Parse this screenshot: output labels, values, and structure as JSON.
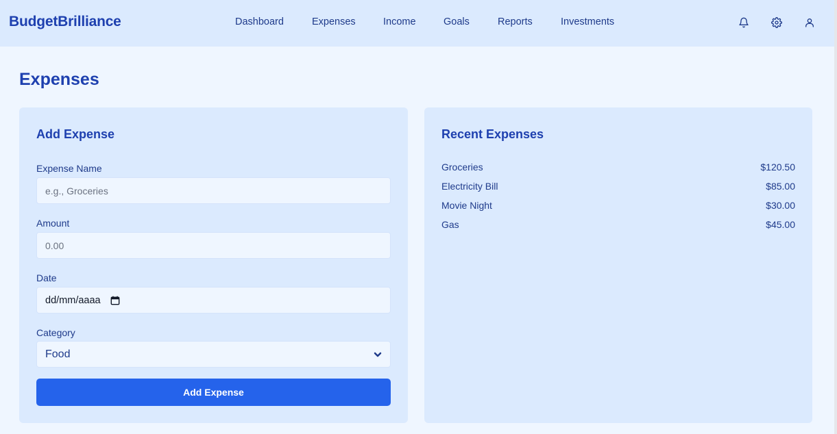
{
  "header": {
    "brand": "BudgetBrilliance",
    "nav": [
      "Dashboard",
      "Expenses",
      "Income",
      "Goals",
      "Reports",
      "Investments"
    ],
    "icons": [
      "bell-icon",
      "gear-icon",
      "user-icon"
    ]
  },
  "page": {
    "title": "Expenses"
  },
  "add_expense": {
    "title": "Add Expense",
    "name_label": "Expense Name",
    "name_placeholder": "e.g., Groceries",
    "amount_label": "Amount",
    "amount_placeholder": "0.00",
    "date_label": "Date",
    "date_placeholder": "dd/mm/aaaa",
    "category_label": "Category",
    "category_value": "Food",
    "submit_label": "Add Expense"
  },
  "recent_expenses": {
    "title": "Recent Expenses",
    "items": [
      {
        "name": "Groceries",
        "amount": "$120.50"
      },
      {
        "name": "Electricity Bill",
        "amount": "$85.00"
      },
      {
        "name": "Movie Night",
        "amount": "$30.00"
      },
      {
        "name": "Gas",
        "amount": "$45.00"
      }
    ]
  },
  "colors": {
    "primary": "#2563eb",
    "header_bg": "#dbeafe",
    "page_bg": "#eff6ff",
    "text": "#1e3a8a"
  }
}
